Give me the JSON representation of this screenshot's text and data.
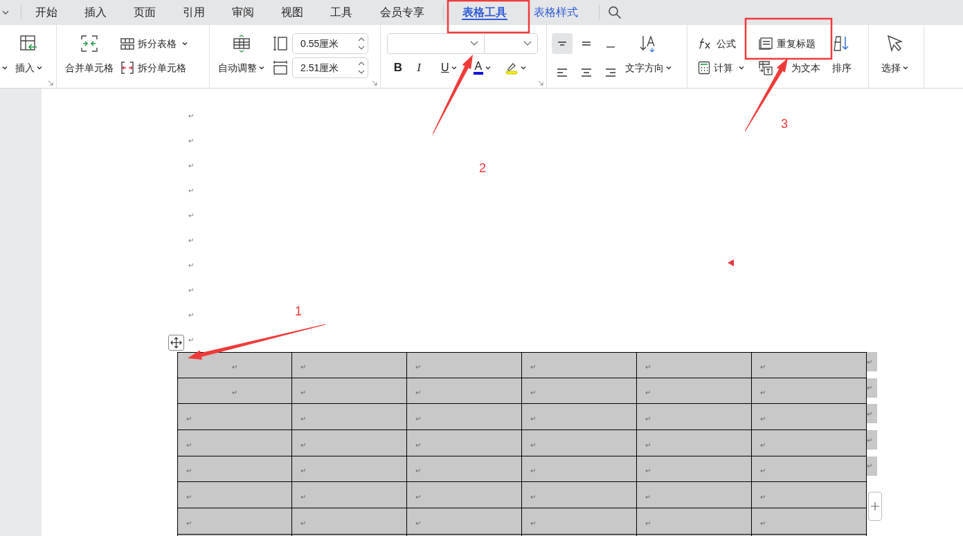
{
  "tabs": [
    {
      "label": "开始",
      "selected": false,
      "kind": "normal"
    },
    {
      "label": "插入",
      "selected": false,
      "kind": "normal"
    },
    {
      "label": "页面",
      "selected": false,
      "kind": "normal"
    },
    {
      "label": "引用",
      "selected": false,
      "kind": "normal"
    },
    {
      "label": "审阅",
      "selected": false,
      "kind": "normal"
    },
    {
      "label": "视图",
      "selected": false,
      "kind": "normal"
    },
    {
      "label": "工具",
      "selected": false,
      "kind": "normal"
    },
    {
      "label": "会员专享",
      "selected": false,
      "kind": "normal"
    },
    {
      "label": "表格工具",
      "selected": true,
      "kind": "contextual"
    },
    {
      "label": "表格样式",
      "selected": false,
      "kind": "contextual"
    }
  ],
  "ribbon": {
    "insert": "插入",
    "merge_cells": "合并单元格",
    "split_table": "拆分表格",
    "split_cells": "拆分单元格",
    "autofit": "自动调整",
    "row_height": "0.55厘米",
    "column_width": "2.51厘米",
    "bold": "B",
    "italic": "I",
    "underline": "U",
    "font_color": "A",
    "alignment": [
      {
        "selected": true
      },
      {
        "selected": false
      },
      {
        "selected": false
      },
      {
        "selected": false
      },
      {
        "selected": false
      },
      {
        "selected": false
      }
    ],
    "text_direction": "文字方向",
    "formula": "公式",
    "repeat_header": "重复标题",
    "calculate": "计算",
    "convert_to_text": "为文本",
    "sort": "排序",
    "select": "选择"
  },
  "document": {
    "paragraph_marks": [
      "↵",
      "↵",
      "↵",
      "↵",
      "↵",
      "↵",
      "↵",
      "↵",
      "↵",
      "↵"
    ],
    "table": {
      "rows": [
        {
          "cells": [
            "↵",
            "↵",
            "↵",
            "↵",
            "↵",
            "↵"
          ],
          "centered_first": true,
          "end_mark": "↵"
        },
        {
          "cells": [
            "↵",
            "↵",
            "↵",
            "↵",
            "↵",
            "↵"
          ],
          "centered_first": true,
          "end_mark": "↵"
        },
        {
          "cells": [
            "↵",
            "↵",
            "↵",
            "↵",
            "↵",
            "↵"
          ],
          "centered_first": false,
          "end_mark": "↵"
        },
        {
          "cells": [
            "↵",
            "↵",
            "↵",
            "↵",
            "↵",
            "↵"
          ],
          "centered_first": false,
          "end_mark": "↵"
        },
        {
          "cells": [
            "↵",
            "↵",
            "↵",
            "↵",
            "↵",
            "↵"
          ],
          "centered_first": false,
          "end_mark": "↵"
        },
        {
          "cells": [
            "↵",
            "↵",
            "↵",
            "↵",
            "↵",
            "↵"
          ],
          "centered_first": false
        },
        {
          "cells": [
            "↵",
            "↵",
            "↵",
            "↵",
            "↵",
            "↵"
          ],
          "centered_first": false
        }
      ]
    }
  },
  "annotations": [
    {
      "label": "1"
    },
    {
      "label": "2"
    },
    {
      "label": "3"
    }
  ]
}
